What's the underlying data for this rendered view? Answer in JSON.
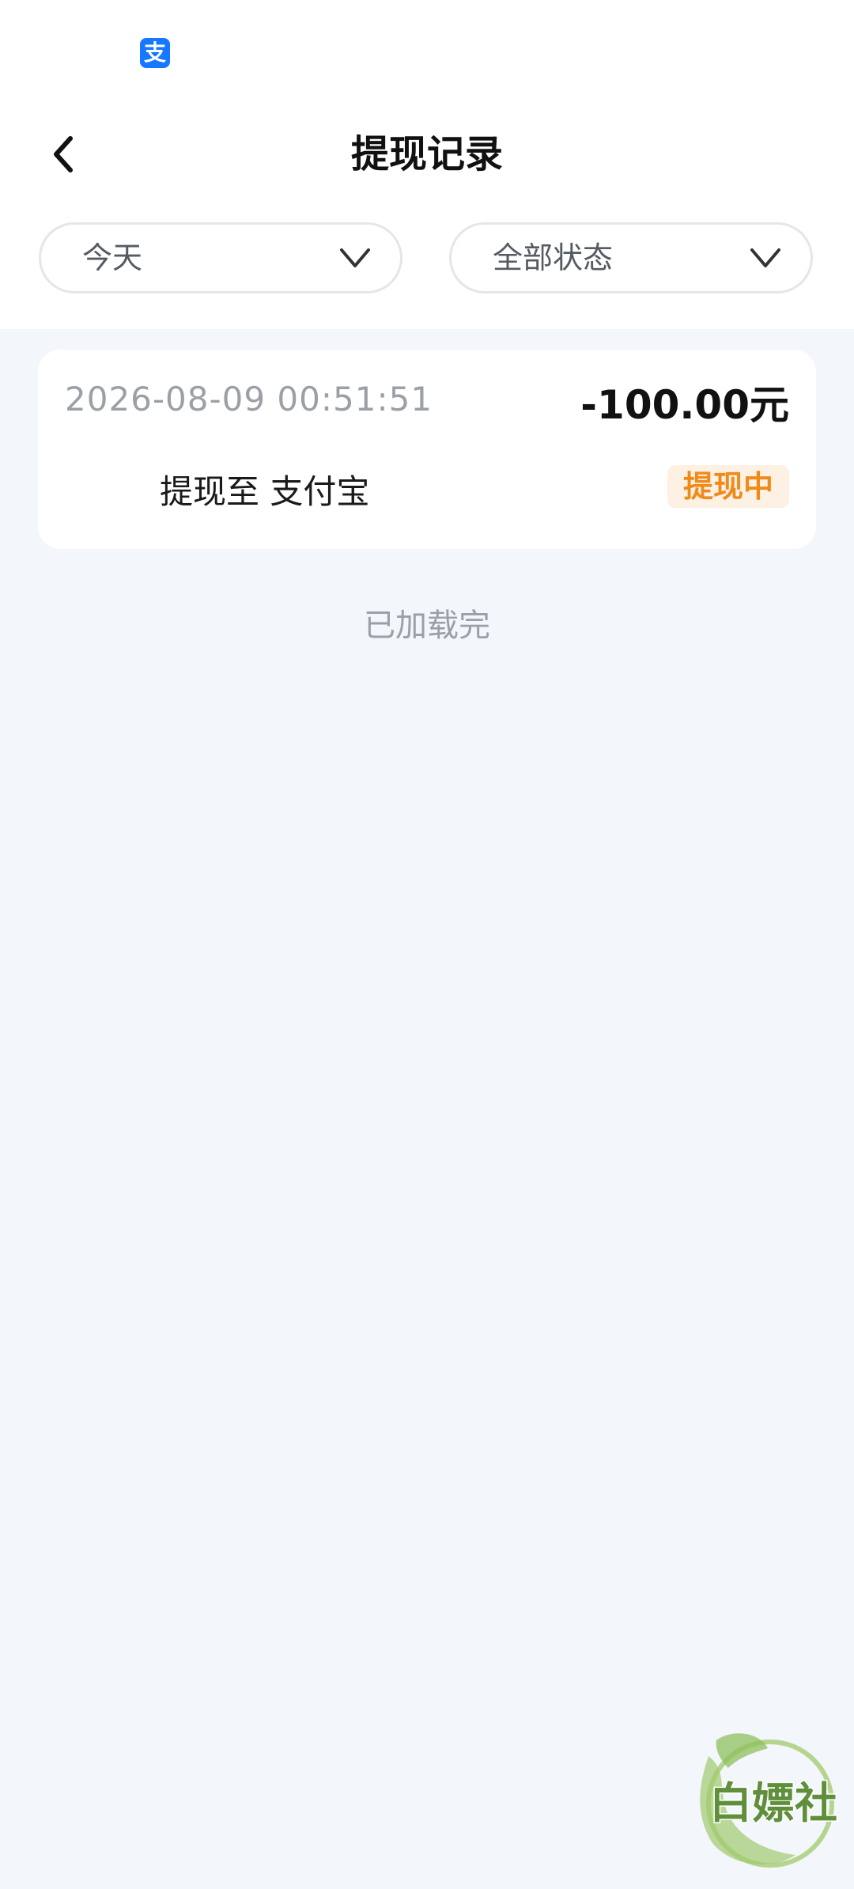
{
  "status_bar": {
    "alipay_glyph": "支",
    "alipay_icon": "alipay-icon"
  },
  "header": {
    "title": "提现记录",
    "back_icon": "chevron-left-icon"
  },
  "filters": {
    "date_label": "今天",
    "status_label": "全部状态",
    "dropdown_icon": "chevron-down-icon"
  },
  "records": [
    {
      "time": "2026-08-09 00:51:51",
      "amount": "-100.00元",
      "description": "提现至 支付宝",
      "status": "提现中"
    }
  ],
  "list_end_text": "已加载完",
  "watermark_text": "白嫖社",
  "colors": {
    "page_bg": "#f3f6fa",
    "status_orange": "#f08a1a",
    "status_badge_bg": "#fdf1e4",
    "alipay_blue": "#1677ff"
  }
}
